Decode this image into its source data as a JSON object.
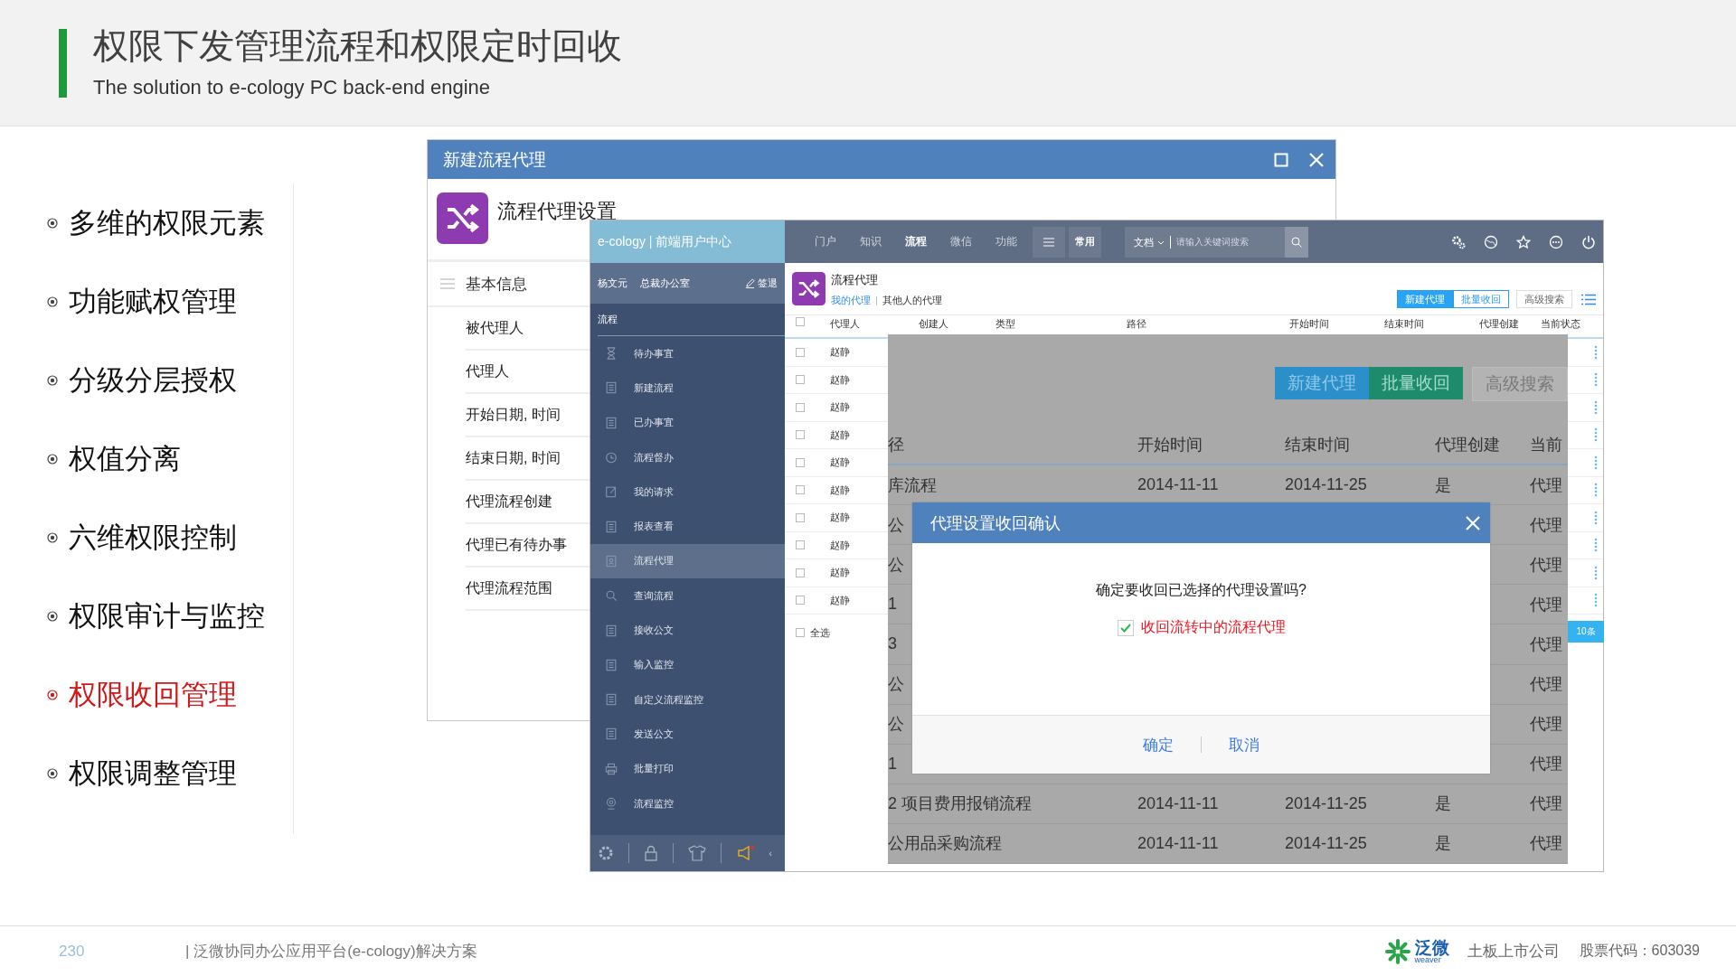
{
  "slide": {
    "title": "权限下发管理流程和权限定时回收",
    "subtitle": "The solution to e-cology PC back-end engine"
  },
  "topics": [
    {
      "label": "多维的权限元素",
      "selected": false
    },
    {
      "label": "功能赋权管理",
      "selected": false
    },
    {
      "label": "分级分层授权",
      "selected": false
    },
    {
      "label": "权值分离",
      "selected": false
    },
    {
      "label": "六维权限控制",
      "selected": false
    },
    {
      "label": "权限审计与监控",
      "selected": false
    },
    {
      "label": "权限收回管理",
      "selected": true
    },
    {
      "label": "权限调整管理",
      "selected": false
    }
  ],
  "settings_window": {
    "title": "新建流程代理",
    "heading": "流程代理设置",
    "section": "基本信息",
    "fields": [
      "被代理人",
      "代理人",
      "开始日期, 时间",
      "结束日期, 时间",
      "代理流程创建",
      "代理已有待办事",
      "代理流程范围"
    ]
  },
  "app_window": {
    "brand": "e-cology | 前端用户中心",
    "user": "杨文元",
    "department": "总裁办公室",
    "logout": "签退",
    "nav": [
      {
        "label": "门户",
        "selected": false
      },
      {
        "label": "知识",
        "selected": false
      },
      {
        "label": "流程",
        "selected": true
      },
      {
        "label": "微信",
        "selected": false
      },
      {
        "label": "功能",
        "selected": false
      }
    ],
    "quick": "常用",
    "search": {
      "scope": "文档",
      "placeholder": "请输入关键词搜索"
    },
    "sidebar_section": "流程",
    "sidebar_items": [
      {
        "label": "待办事宜",
        "kind": "hourglass",
        "selected": false
      },
      {
        "label": "新建流程",
        "kind": "document",
        "selected": false
      },
      {
        "label": "已办事宜",
        "kind": "document",
        "selected": false
      },
      {
        "label": "流程督办",
        "kind": "clock",
        "selected": false
      },
      {
        "label": "我的请求",
        "kind": "edit",
        "selected": false
      },
      {
        "label": "报表查看",
        "kind": "document",
        "selected": false
      },
      {
        "label": "流程代理",
        "kind": "contact",
        "selected": true
      },
      {
        "label": "查询流程",
        "kind": "search",
        "selected": false
      },
      {
        "label": "接收公文",
        "kind": "document",
        "selected": false
      },
      {
        "label": "输入监控",
        "kind": "document",
        "selected": false
      },
      {
        "label": "自定义流程监控",
        "kind": "document",
        "selected": false
      },
      {
        "label": "发送公文",
        "kind": "document",
        "selected": false
      },
      {
        "label": "批量打印",
        "kind": "printer",
        "selected": false
      },
      {
        "label": "流程监控",
        "kind": "webcam",
        "selected": false
      }
    ],
    "collapse": "‹",
    "page_title": "流程代理",
    "tabs": [
      {
        "label": "我的代理",
        "selected": true
      },
      {
        "label": "其他人的代理",
        "selected": false
      }
    ],
    "actions": [
      {
        "label": "新建代理",
        "kind": "primary"
      },
      {
        "label": "批量收回",
        "kind": "outline"
      },
      {
        "label": "高级搜索",
        "kind": "plain"
      }
    ],
    "table": {
      "columns": [
        "代理人",
        "创建人",
        "类型",
        "路径",
        "开始时间",
        "结束时间",
        "代理创建",
        "当前状态"
      ],
      "rows": [
        {
          "agent": "赵静",
          "checked": false
        },
        {
          "agent": "赵静",
          "checked": false
        },
        {
          "agent": "赵静",
          "checked": false
        },
        {
          "agent": "赵静",
          "checked": false
        },
        {
          "agent": "赵静",
          "checked": false
        },
        {
          "agent": "赵静",
          "checked": false
        },
        {
          "agent": "赵静",
          "checked": false
        },
        {
          "agent": "赵静",
          "checked": false
        },
        {
          "agent": "赵静",
          "checked": false
        },
        {
          "agent": "赵静",
          "checked": false
        }
      ],
      "header_checked": false,
      "select_all": {
        "label": "全选",
        "checked": false
      },
      "count": "10条"
    }
  },
  "magnified": {
    "actions": [
      {
        "label": "新建代理",
        "kind": "primary"
      },
      {
        "label": "批量收回",
        "kind": "success"
      },
      {
        "label": "高级搜索",
        "kind": "plain"
      }
    ],
    "columns": [
      "径",
      "开始时间",
      "结束时间",
      "代理创建",
      "当前"
    ],
    "rows": [
      {
        "path": "库流程",
        "start": "2014-11-11",
        "end": "2014-11-25",
        "created": "是",
        "state": "代理"
      },
      {
        "path": "公",
        "state": "代理"
      },
      {
        "path": "公",
        "state": "代理"
      },
      {
        "path": "1",
        "state": "代理"
      },
      {
        "path": "3",
        "state": "代理"
      },
      {
        "path": "公",
        "state": "代理"
      },
      {
        "path": "公",
        "state": "代理"
      },
      {
        "path": "1",
        "state": "代理"
      },
      {
        "path": "2 项目费用报销流程",
        "start": "2014-11-11",
        "end": "2014-11-25",
        "created": "是",
        "state": "代理"
      },
      {
        "path": "公用品采购流程",
        "start": "2014-11-11",
        "end": "2014-11-25",
        "created": "是",
        "state": "代理"
      }
    ]
  },
  "dialog": {
    "title": "代理设置收回确认",
    "message": "确定要收回已选择的代理设置吗?",
    "option": {
      "label": "收回流转中的流程代理",
      "checked": true
    },
    "buttons": [
      "确定",
      "取消"
    ]
  },
  "footer": {
    "page": "230",
    "caption": "| 泛微协同办公应用平台(e-cology)解决方案",
    "logo_text": "泛微",
    "logo_sub": "weaver",
    "company": "土板上市公司",
    "stock": "股票代码：603039"
  }
}
